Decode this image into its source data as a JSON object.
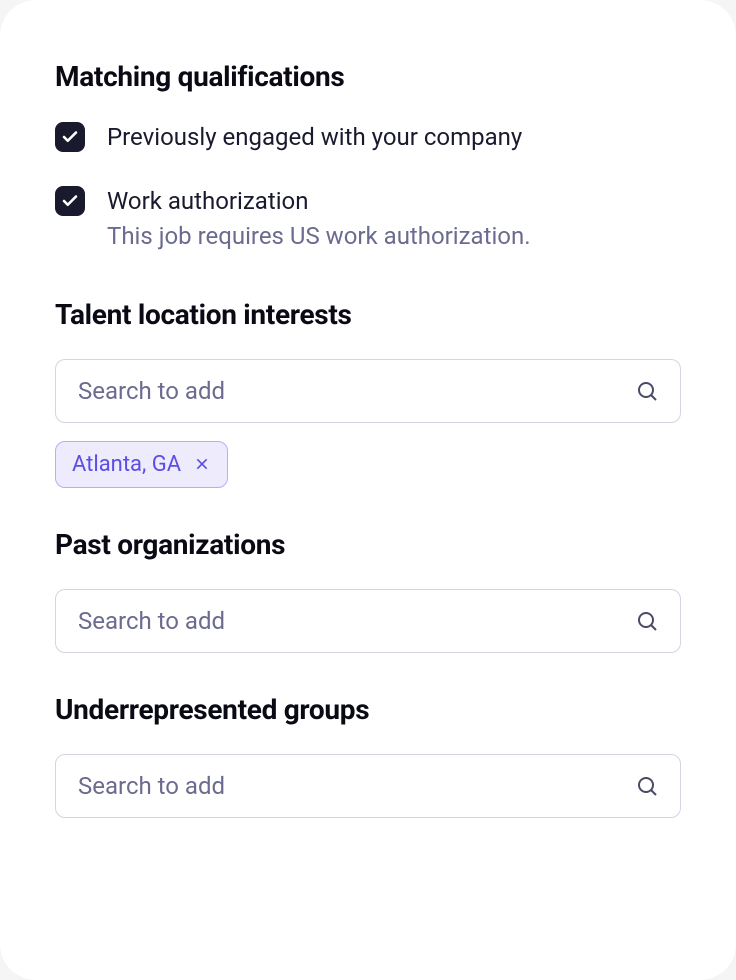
{
  "matching": {
    "title": "Matching qualifications",
    "items": [
      {
        "label": "Previously engaged with your company",
        "checked": true
      },
      {
        "label": "Work authorization",
        "subtext": "This job requires US work authorization.",
        "checked": true
      }
    ]
  },
  "locations": {
    "title": "Talent location interests",
    "placeholder": "Search to add",
    "chips": [
      {
        "label": "Atlanta, GA"
      }
    ]
  },
  "organizations": {
    "title": "Past organizations",
    "placeholder": "Search to add"
  },
  "groups": {
    "title": "Underrepresented groups",
    "placeholder": "Search to add"
  }
}
